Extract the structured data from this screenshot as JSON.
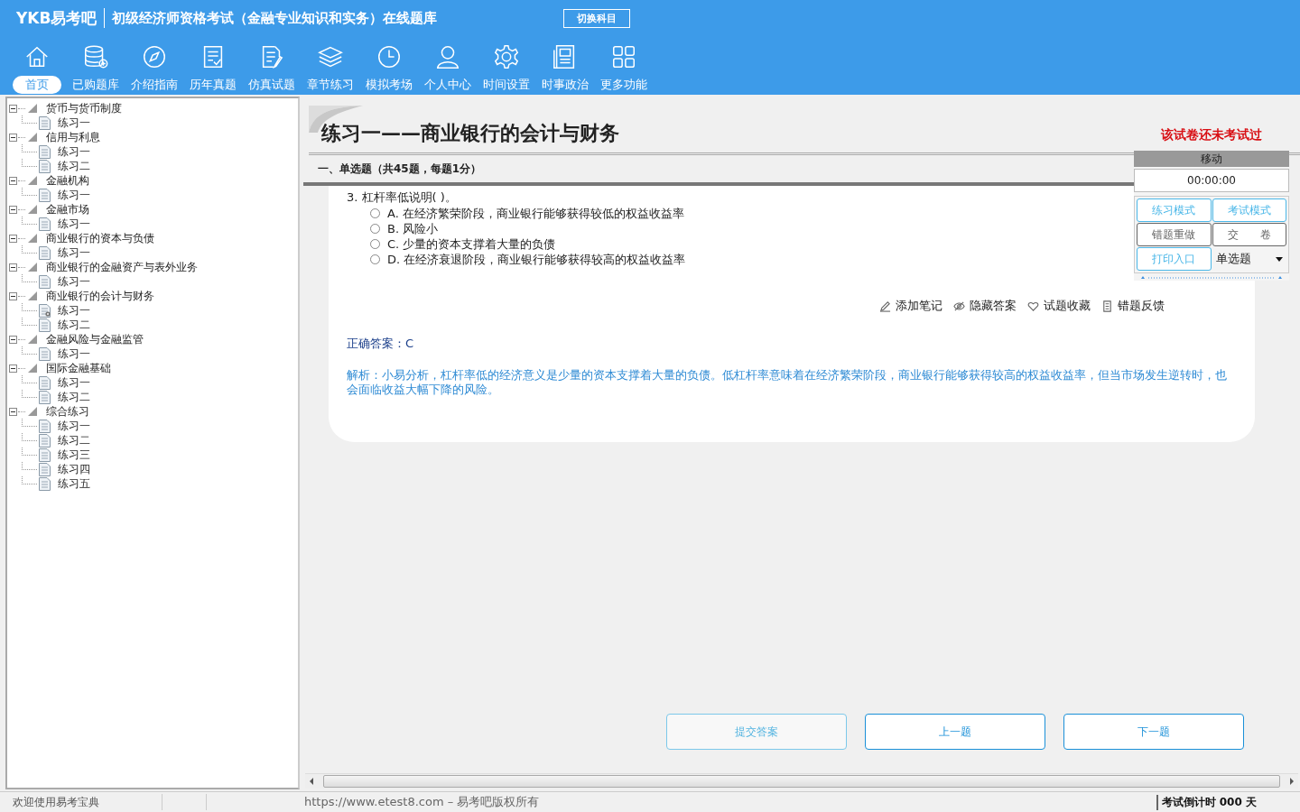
{
  "header": {
    "logo": "YKB易考吧",
    "title": "初级经济师资格考试（金融专业知识和实务）在线题库",
    "switch_button": "切换科目"
  },
  "toolbar": [
    {
      "kind": "home",
      "label": "首页",
      "selected": true
    },
    {
      "kind": "database",
      "label": "已购题库",
      "selected": false
    },
    {
      "kind": "compass",
      "label": "介绍指南",
      "selected": false
    },
    {
      "kind": "list",
      "label": "历年真题",
      "selected": false
    },
    {
      "kind": "edit",
      "label": "仿真试题",
      "selected": false
    },
    {
      "kind": "layers",
      "label": "章节练习",
      "selected": false
    },
    {
      "kind": "clock",
      "label": "模拟考场",
      "selected": false
    },
    {
      "kind": "person",
      "label": "个人中心",
      "selected": false
    },
    {
      "kind": "gear",
      "label": "时间设置",
      "selected": false
    },
    {
      "kind": "news",
      "label": "时事政治",
      "selected": false
    },
    {
      "kind": "grid",
      "label": "更多功能",
      "selected": false
    }
  ],
  "tree": [
    {
      "label": "货币与货币制度",
      "expanded": true,
      "children": [
        {
          "label": "练习一",
          "active": false
        }
      ]
    },
    {
      "label": "信用与利息",
      "expanded": true,
      "children": [
        {
          "label": "练习一",
          "active": false
        },
        {
          "label": "练习二",
          "active": false
        }
      ]
    },
    {
      "label": "金融机构",
      "expanded": true,
      "children": [
        {
          "label": "练习一",
          "active": false
        }
      ]
    },
    {
      "label": "金融市场",
      "expanded": true,
      "children": [
        {
          "label": "练习一",
          "active": false
        }
      ]
    },
    {
      "label": "商业银行的资本与负债",
      "expanded": true,
      "children": [
        {
          "label": "练习一",
          "active": false
        }
      ]
    },
    {
      "label": "商业银行的金融资产与表外业务",
      "expanded": true,
      "children": [
        {
          "label": "练习一",
          "active": false
        }
      ]
    },
    {
      "label": "商业银行的会计与财务",
      "expanded": true,
      "children": [
        {
          "label": "练习一",
          "active": true
        },
        {
          "label": "练习二",
          "active": false
        }
      ]
    },
    {
      "label": "金融风险与金融监管",
      "expanded": true,
      "children": [
        {
          "label": "练习一",
          "active": false
        }
      ]
    },
    {
      "label": "国际金融基础",
      "expanded": true,
      "children": [
        {
          "label": "练习一",
          "active": false
        },
        {
          "label": "练习二",
          "active": false
        }
      ]
    },
    {
      "label": "综合练习",
      "expanded": true,
      "children": [
        {
          "label": "练习一",
          "active": false
        },
        {
          "label": "练习二",
          "active": false
        },
        {
          "label": "练习三",
          "active": false
        },
        {
          "label": "练习四",
          "active": false
        },
        {
          "label": "练习五",
          "active": false
        }
      ]
    }
  ],
  "exam": {
    "title": "练习一——商业银行的会计与财务",
    "status": "该试卷还未考试过",
    "section": "一、单选题（共45题，每题1分）",
    "question": "3. 杠杆率低说明( )。",
    "options": [
      {
        "text": "A. 在经济繁荣阶段，商业银行能够获得较低的权益收益率",
        "checked": false
      },
      {
        "text": "B. 风险小",
        "checked": false
      },
      {
        "text": "C. 少量的资本支撑着大量的负债",
        "checked": false
      },
      {
        "text": "D. 在经济衰退阶段，商业银行能够获得较高的权益收益率",
        "checked": false
      }
    ],
    "actions": [
      {
        "kind": "pencil",
        "label": "添加笔记"
      },
      {
        "kind": "eye",
        "label": "隐藏答案"
      },
      {
        "kind": "heart",
        "label": "试题收藏"
      },
      {
        "kind": "book",
        "label": "错题反馈"
      }
    ],
    "answer_label": "正确答案：",
    "answer": "C",
    "analysis": "解析：小易分析，杠杆率低的经济意义是少量的资本支撑着大量的负债。低杠杆率意味着在经济繁荣阶段，商业银行能够获得较高的权益收益率，但当市场发生逆转时，也会面临收益大幅下降的风险。"
  },
  "panel": {
    "title": "移动",
    "timer": "00:00:00",
    "buttons": [
      {
        "label": "练习模式",
        "highlighted": true
      },
      {
        "label": "考试模式",
        "highlighted": true
      },
      {
        "label": "错题重做",
        "highlighted": false
      },
      {
        "label": "交　　卷",
        "highlighted": false
      },
      {
        "label": "打印入口",
        "highlighted": true
      }
    ],
    "type_select": "单选题"
  },
  "nav_buttons": [
    {
      "label": "提交答案",
      "disabled": true
    },
    {
      "label": "上一题",
      "disabled": false
    },
    {
      "label": "下一题",
      "disabled": false
    }
  ],
  "status_bar": {
    "welcome": "欢迎使用易考宝典",
    "copyright": "https://www.etest8.com – 易考吧版权所有",
    "countdown": "考试倒计时 000 天"
  }
}
